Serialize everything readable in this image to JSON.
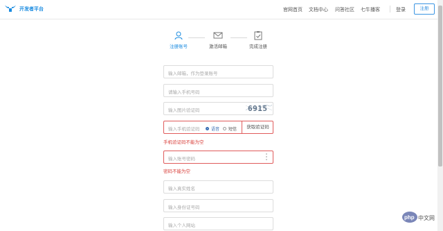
{
  "header": {
    "logo_text": "开发者平台",
    "nav": [
      "官网首页",
      "文档中心",
      "问答社区",
      "七牛播客"
    ],
    "login": "登录",
    "register": "注册"
  },
  "steps": [
    {
      "label": "注册账号",
      "icon": "user-icon",
      "active": true
    },
    {
      "label": "激活邮箱",
      "icon": "mail-icon",
      "active": false
    },
    {
      "label": "完成注册",
      "icon": "clipboard-check-icon",
      "active": false
    }
  ],
  "form": {
    "email_placeholder": "输入邮箱，作为登录账号",
    "phone_placeholder": "请输入手机号码",
    "image_code_placeholder": "输入图片验证码",
    "captcha_text": "6915",
    "sms_code_placeholder": "输入手机验证码",
    "radio_voice": "语音",
    "radio_sms": "短信",
    "get_code": "获取验证码",
    "sms_code_error": "手机验证码不能为空",
    "password_placeholder": "输入账号密码",
    "password_error": "密码不能为空",
    "realname_placeholder": "输入真实姓名",
    "idcard_placeholder": "输入身份证号码",
    "website_placeholder": "输入个人网站"
  },
  "watermark": {
    "text": "php",
    "subtext": "中文网"
  },
  "colors": {
    "accent": "#1a8be0",
    "error": "#d9413c"
  }
}
